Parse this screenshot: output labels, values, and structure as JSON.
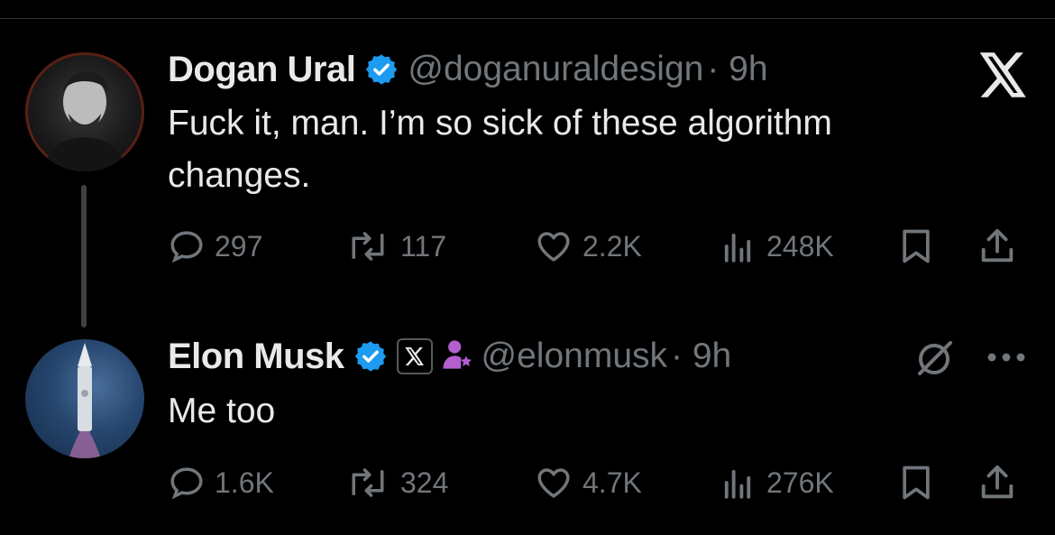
{
  "tweet1": {
    "name": "Dogan Ural",
    "handle": "@doganuraldesign",
    "time": "· 9h",
    "text": "Fuck it, man. I’m so sick of these algorithm changes.",
    "replies": "297",
    "reposts": "117",
    "likes": "2.2K",
    "views": "248K"
  },
  "tweet2": {
    "name": "Elon Musk",
    "handle": "@elonmusk",
    "time": "· 9h",
    "text": "Me too",
    "replies": "1.6K",
    "reposts": "324",
    "likes": "4.7K",
    "views": "276K"
  },
  "colors": {
    "background": "#000000",
    "text_primary": "#e7e9ea",
    "text_secondary": "#71767b",
    "verified_blue": "#1d9bf0",
    "affiliate_purple": "#b45fcf"
  },
  "icons": [
    "x-logo-icon",
    "verified-icon",
    "reply-icon",
    "repost-icon",
    "like-icon",
    "views-icon",
    "bookmark-icon",
    "share-icon",
    "grok-icon",
    "more-icon",
    "affiliate-icon"
  ]
}
